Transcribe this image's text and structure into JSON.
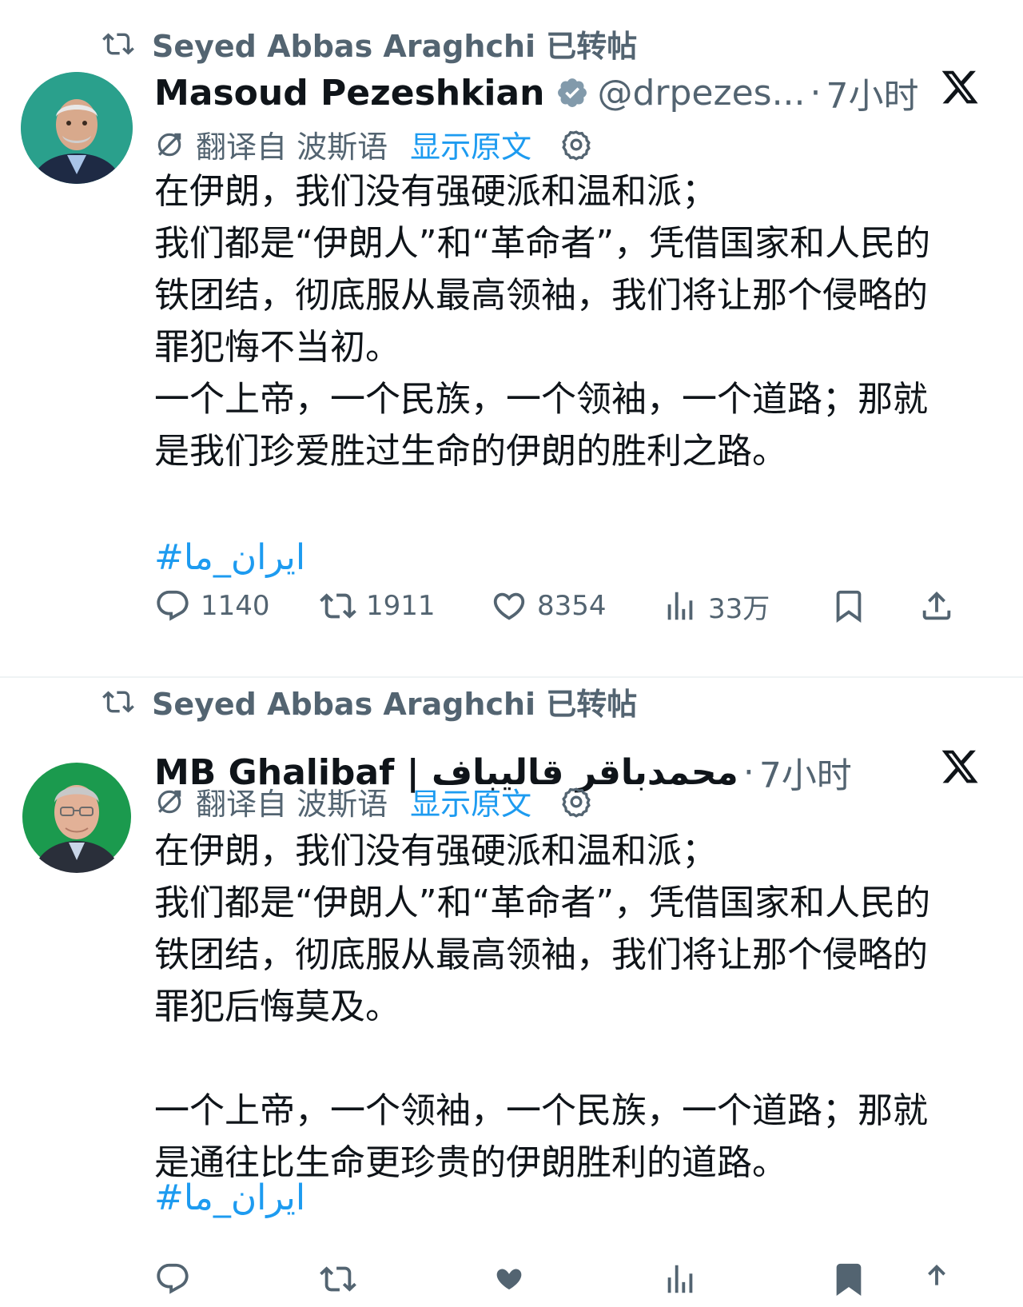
{
  "tweets": [
    {
      "repost_label": "Seyed Abbas Araghchi 已转帖",
      "display_name": "Masoud Pezeshkian",
      "verified": true,
      "handle": "@drpezes...",
      "separator": "·",
      "time": "7小时",
      "translation_label": "翻译自 波斯语",
      "show_original": "显示原文",
      "body_lines": [
        "在伊朗，我们没有强硬派和温和派；",
        "我们都是“伊朗人”和“革命者”，凭借国家和人民的",
        "铁团结，彻底服从最高领袖，我们将让那个侵略的",
        "罪犯悔不当初。",
        "一个上帝，一个民族，一个领袖，一个道路；那就",
        "是我们珍爱胜过生命的伊朗的胜利之路。"
      ],
      "hashtag": "#ایران_ما",
      "stats": {
        "replies": "1140",
        "reposts": "1911",
        "likes": "8354",
        "views": "33万"
      }
    },
    {
      "repost_label": "Seyed Abbas Araghchi 已转帖",
      "display_name": "MB Ghalibaf | محمدباقر قالیباف",
      "verified": false,
      "separator": "·",
      "time": "7小时",
      "translation_label": "翻译自 波斯语",
      "show_original": "显示原文",
      "body_lines": [
        "在伊朗，我们没有强硬派和温和派；",
        "我们都是“伊朗人”和“革命者”，凭借国家和人民的",
        "铁团结，彻底服从最高领袖，我们将让那个侵略的",
        "罪犯后悔莫及。",
        "",
        "一个上帝，一个领袖，一个民族，一个道路；那就",
        "是通往比生命更珍贵的伊朗胜利的道路。"
      ],
      "hashtag": "#ایران_ما"
    }
  ],
  "colors": {
    "text_primary": "#0f1419",
    "text_secondary": "#536471",
    "link": "#1d9bf0",
    "separator": "#eff3f4"
  },
  "icons": {
    "repost": "repost-icon",
    "verified": "verified-badge-icon",
    "x_logo": "x-logo-icon",
    "translate": "translate-icon",
    "settings": "gear-icon",
    "reply": "reply-icon",
    "like": "heart-icon",
    "views": "views-bar-chart-icon",
    "bookmark": "bookmark-icon",
    "share": "share-icon"
  }
}
